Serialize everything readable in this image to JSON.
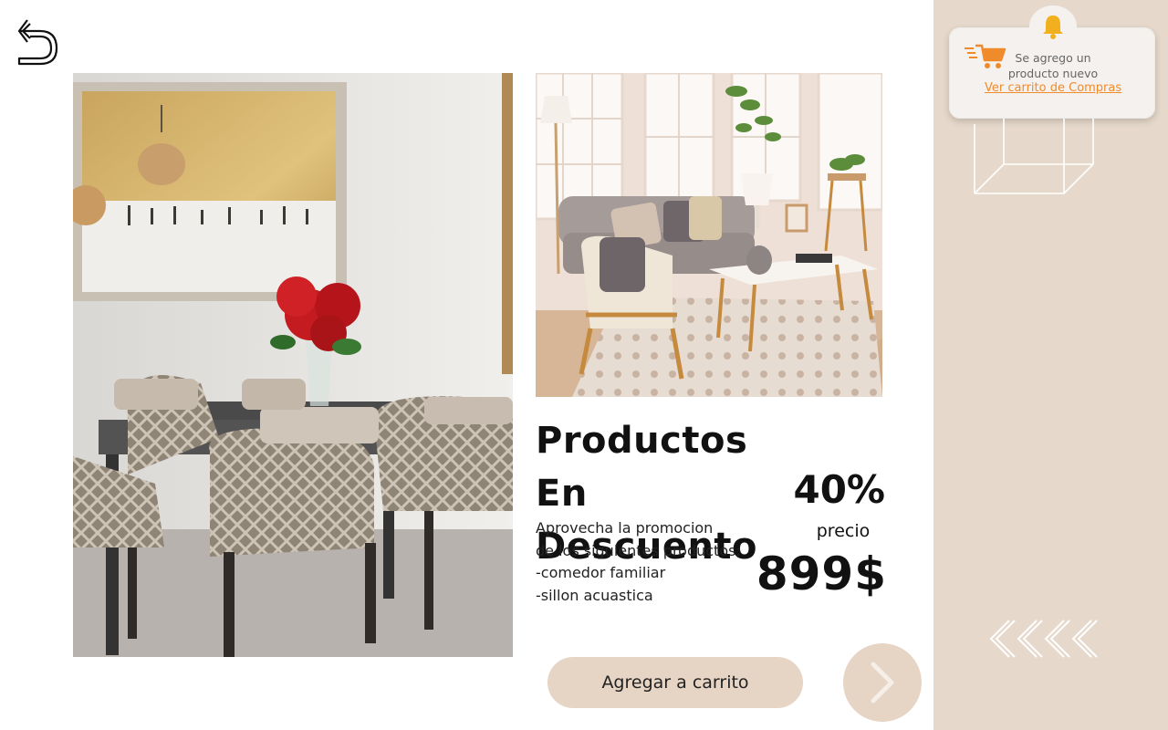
{
  "navigation": {
    "back_icon": "back-arrow-icon"
  },
  "promo": {
    "title_line1": "Productos En",
    "title_line2": "Descuento",
    "discount": "40%",
    "description": [
      "Aprovecha la promocion",
      "de los siguientes productos:",
      "-comedor familiar",
      "-sillon  acuastica"
    ],
    "price_label": "precio",
    "price": "899$"
  },
  "actions": {
    "add_to_cart": "Agregar a carrito",
    "next_icon": "chevron-right-icon"
  },
  "notification": {
    "line1": "Se agrego un",
    "line2": "producto nuevo",
    "link": "Ver carrito de Compras",
    "bell_icon": "bell-icon",
    "cart_icon": "shopping-cart-icon"
  },
  "colors": {
    "sidebar_bg": "#e6d9cb",
    "button_bg": "#e6d4c4",
    "link_color": "#f08b2c",
    "bell_color": "#f2b01e"
  }
}
